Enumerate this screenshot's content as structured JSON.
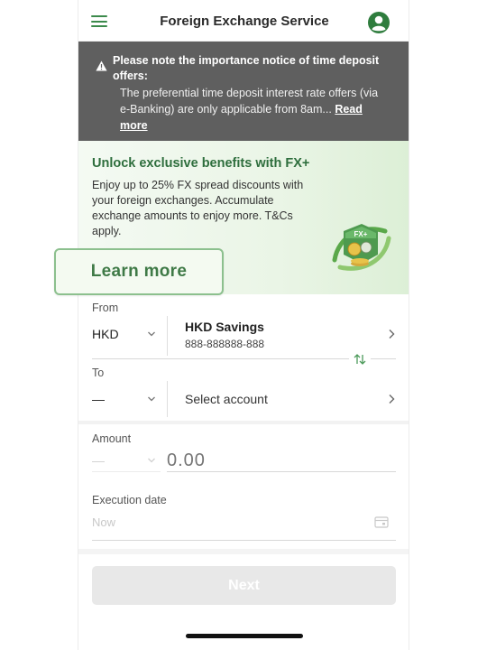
{
  "header": {
    "title": "Foreign Exchange Service",
    "menu_icon": "hamburger-menu-icon",
    "profile_icon": "user-profile-icon"
  },
  "notice": {
    "icon": "warning-icon",
    "title": "Please note the importance notice of time deposit offers:",
    "body": "The preferential time deposit interest rate offers (via e-Banking) are only applicable from 8am...",
    "read_more": "Read more"
  },
  "promo": {
    "title": "Unlock exclusive benefits with FX+",
    "text": "Enjoy up to 25% FX spread discounts with your foreign exchanges. Accumulate exchange amounts to enjoy more. T&Cs apply.",
    "learn_more": "Learn more",
    "graphic_label": "FX+"
  },
  "form": {
    "from_label": "From",
    "from_currency": "HKD",
    "from_account_name": "HKD Savings",
    "from_account_number": "888-888888-888",
    "to_label": "To",
    "to_currency": "—",
    "to_account": "Select account",
    "amount_label": "Amount",
    "amount_currency": "—",
    "amount_placeholder": "0.00",
    "execution_label": "Execution date",
    "execution_placeholder": "Now",
    "next_button": "Next"
  },
  "colors": {
    "accent_green": "#3c8a4b",
    "notice_bg": "#5f5f5f",
    "promo_title": "#2e6e3d",
    "disabled_button": "#e8e8e8"
  }
}
